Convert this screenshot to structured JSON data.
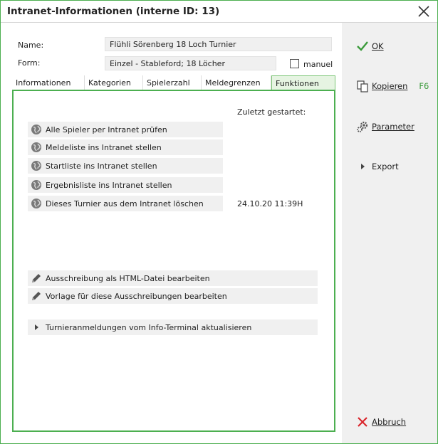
{
  "window": {
    "title": "Intranet-Informationen (interne ID: 13)"
  },
  "form": {
    "name_label": "Name:",
    "name_value": "Flühli Sörenberg 18 Loch Turnier",
    "form_label": "Form:",
    "form_value": "Einzel - Stableford; 18 Löcher",
    "manuel_label": "manuel",
    "manuel_checked": false
  },
  "tabs": [
    {
      "label": "Informationen",
      "active": false
    },
    {
      "label": "Kategorien",
      "active": false
    },
    {
      "label": "Spielerzahl",
      "active": false
    },
    {
      "label": "Meldegrenzen",
      "active": false
    },
    {
      "label": "Funktionen",
      "active": true
    }
  ],
  "functions": {
    "last_started_header": "Zuletzt gestartet:",
    "intranet_actions": [
      {
        "label": "Alle Spieler per Intranet prüfen",
        "icon": "globe-icon"
      },
      {
        "label": "Meldeliste ins Intranet stellen",
        "icon": "globe-icon"
      },
      {
        "label": "Startliste ins Intranet stellen",
        "icon": "globe-icon"
      },
      {
        "label": "Ergebnisliste ins Intranet stellen",
        "icon": "globe-icon"
      },
      {
        "label": "Dieses Turnier aus dem Intranet löschen",
        "icon": "globe-icon"
      }
    ],
    "last_started_value": "24.10.20 11:39H",
    "edit_actions": [
      {
        "label": "Ausschreibung als HTML-Datei bearbeiten",
        "icon": "pencil-icon"
      },
      {
        "label": "Vorlage für diese Ausschreibungen bearbeiten",
        "icon": "pencil-icon"
      }
    ],
    "terminal_action": {
      "label": "Turnieranmeldungen vom Info-Terminal aktualisieren",
      "icon": "triangle-right-icon"
    }
  },
  "sidebar": {
    "ok_label": "OK",
    "copy_label": "Kopieren",
    "copy_key": "F6",
    "params_label": "Parameter",
    "export_label": "Export",
    "cancel_label": "Abbruch"
  },
  "colors": {
    "accent_green": "#4caf50",
    "cancel_red": "#d9262c",
    "ok_green": "#3a9a3a"
  }
}
